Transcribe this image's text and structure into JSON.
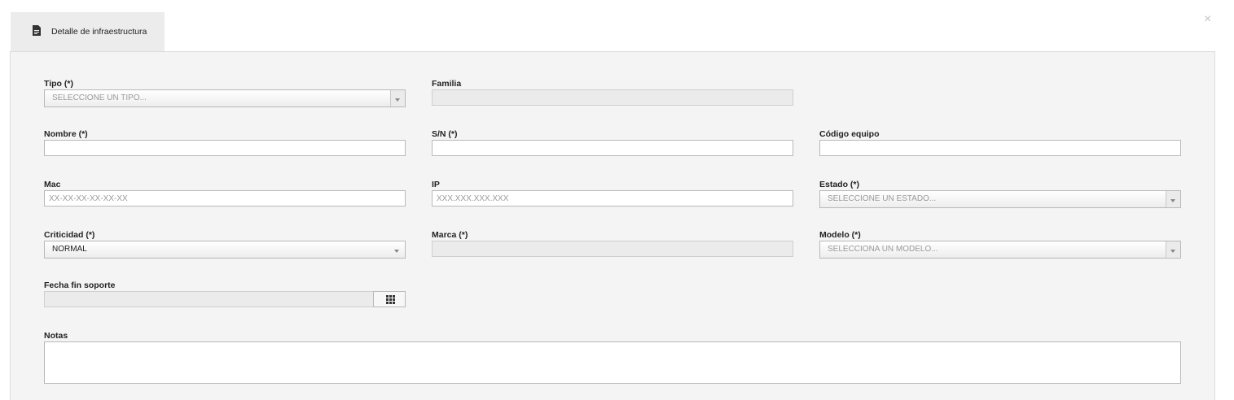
{
  "tab": {
    "label": "Detalle de infraestructura",
    "icon": "document-icon"
  },
  "close": {
    "label": "×"
  },
  "fields": {
    "tipo": {
      "label": "Tipo (*)",
      "value": "SELECCIONE UN TIPO..."
    },
    "familia": {
      "label": "Familia",
      "value": ""
    },
    "nombre": {
      "label": "Nombre (*)",
      "value": ""
    },
    "sn": {
      "label": "S/N (*)",
      "value": ""
    },
    "codigo_equipo": {
      "label": "Código equipo",
      "value": ""
    },
    "mac": {
      "label": "Mac",
      "placeholder": "XX-XX-XX-XX-XX-XX"
    },
    "ip": {
      "label": "IP",
      "placeholder": "XXX.XXX.XXX.XXX"
    },
    "estado": {
      "label": "Estado (*)",
      "value": "SELECCIONE UN ESTADO..."
    },
    "criticidad": {
      "label": "Criticidad (*)",
      "value": "NORMAL"
    },
    "marca": {
      "label": "Marca (*)",
      "value": ""
    },
    "modelo": {
      "label": "Modelo (*)",
      "value": "SELECCIONA UN MODELO..."
    },
    "fecha_fin_soporte": {
      "label": "Fecha fin soporte",
      "value": "",
      "button_icon": "calendar-grid-icon"
    },
    "notas": {
      "label": "Notas",
      "value": ""
    }
  }
}
